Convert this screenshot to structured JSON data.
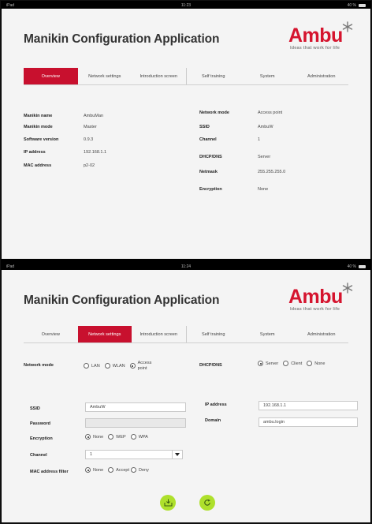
{
  "status": {
    "left": "iPad",
    "time1": "11:23",
    "time2": "11:24",
    "right": "40 %"
  },
  "app": {
    "title": "Manikin Configuration Application"
  },
  "logo": {
    "word": "Ambu",
    "tagline": "Ideas that work for life"
  },
  "tabs": [
    {
      "label": "Overview"
    },
    {
      "label": "Network settings"
    },
    {
      "label": "Introduction screen"
    },
    {
      "label": "Self training"
    },
    {
      "label": "System"
    },
    {
      "label": "Administration"
    }
  ],
  "overview": {
    "left": [
      {
        "label": "Manikin name",
        "value": "AmbuMan"
      },
      {
        "label": "Manikin mode",
        "value": "Master"
      },
      {
        "label": "Software version",
        "value": "0.9.3"
      },
      {
        "label": "IP address",
        "value": "192.168.1.1"
      },
      {
        "label": "MAC address",
        "value": "p2-02"
      }
    ],
    "right": [
      {
        "label": "Network mode",
        "value": "Access point"
      },
      {
        "label": "SSID",
        "value": "AmbuW"
      },
      {
        "label": "Channel",
        "value": "1"
      },
      {
        "label": "DHCP/DNS",
        "value": "Server"
      },
      {
        "label": "Netmask",
        "value": "255.255.255.0"
      },
      {
        "label": "Encryption",
        "value": "None"
      }
    ]
  },
  "network": {
    "network_mode": {
      "label": "Network mode",
      "options": [
        "LAN",
        "WLAN",
        "Access point"
      ],
      "selected": "Access point"
    },
    "dhcp_dns": {
      "label": "DHCP/DNS",
      "options": [
        "Server",
        "Client",
        "None"
      ],
      "selected": "Server"
    },
    "ssid": {
      "label": "SSID",
      "value": "AmbuW"
    },
    "password": {
      "label": "Password",
      "value": ""
    },
    "encryption": {
      "label": "Encryption",
      "options": [
        "None",
        "WEP",
        "WPA"
      ],
      "selected": "None"
    },
    "channel": {
      "label": "Channel",
      "value": "1"
    },
    "mac_filter": {
      "label": "MAC address filter",
      "options": [
        "None",
        "Accept",
        "Deny"
      ],
      "selected": "None"
    },
    "ip_address": {
      "label": "IP address",
      "value": "192.168.1.1"
    },
    "domain": {
      "label": "Domain",
      "value": "ambu.login"
    }
  },
  "colors": {
    "accent": "#c8102e",
    "action": "#aee02c"
  }
}
